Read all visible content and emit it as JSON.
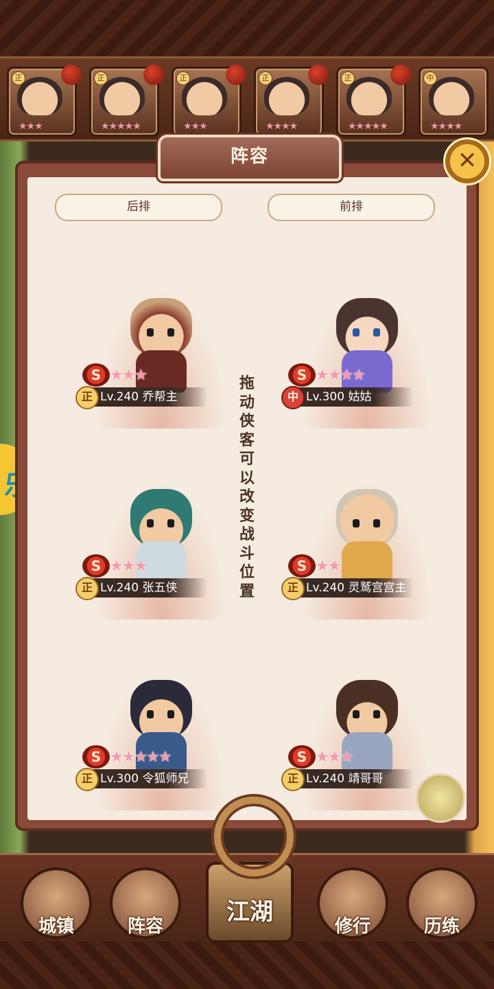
{
  "top_roster": [
    {
      "tag": "正",
      "stars": "★★★"
    },
    {
      "tag": "正",
      "stars": "★★★★★"
    },
    {
      "tag": "正",
      "stars": "★★★"
    },
    {
      "tag": "正",
      "stars": "★★★★"
    },
    {
      "tag": "正",
      "stars": "★★★★★"
    },
    {
      "tag": "中",
      "stars": "★★★★"
    }
  ],
  "panel": {
    "title": "阵容",
    "close_icon": "✕",
    "back_row_label": "后排",
    "front_row_label": "前排",
    "hint": "拖动侠客可以改变战斗位置"
  },
  "heroes": {
    "back": [
      {
        "badge": "正",
        "level_name": "Lv.240 乔帮主",
        "stars": "★★★",
        "rank": "S"
      },
      {
        "badge": "正",
        "level_name": "Lv.240 张五侠",
        "stars": "★★★",
        "rank": "S"
      },
      {
        "badge": "正",
        "level_name": "Lv.300 令狐师兄",
        "stars": "★★★★★",
        "rank": "S"
      }
    ],
    "front": [
      {
        "badge": "中",
        "level_name": "Lv.300 姑姑",
        "stars": "★★★★",
        "rank": "S"
      },
      {
        "badge": "正",
        "level_name": "Lv.240 灵鹫宫宫主",
        "stars": "★★",
        "rank": "S"
      },
      {
        "badge": "正",
        "level_name": "Lv.240 靖哥哥",
        "stars": "★★★",
        "rank": "S"
      }
    ]
  },
  "side_tab": {
    "label": "乐"
  },
  "nav": {
    "town": "城镇",
    "lineup": "阵容",
    "jianghu": "江湖",
    "practice": "修行",
    "training": "历练"
  },
  "colors": {
    "panel_bg": "#f5ebe0",
    "frame": "#8a4a3a",
    "accent_gold": "#f2cf6a",
    "star_pink": "#f49aac"
  }
}
